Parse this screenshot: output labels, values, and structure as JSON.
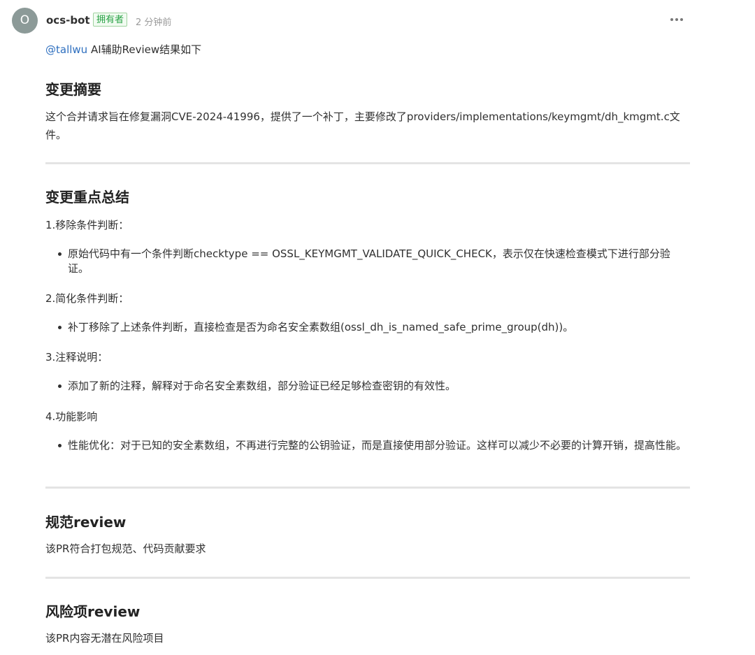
{
  "comment": {
    "avatar_initial": "O",
    "author": "ocs-bot",
    "badge": "拥有者",
    "timestamp": "2 分钟前",
    "mention": "@tallwu",
    "intro_text": " AI辅助Review结果如下"
  },
  "sections": {
    "summary": {
      "heading": "变更摘要",
      "body": "这个合并请求旨在修复漏洞CVE-2024-41996，提供了一个补丁，主要修改了providers/implementations/keymgmt/dh_kmgmt.c文件。"
    },
    "key_points": {
      "heading": "变更重点总结",
      "items": [
        {
          "title": "1.移除条件判断：",
          "bullet": "原始代码中有一个条件判断checktype == OSSL_KEYMGMT_VALIDATE_QUICK_CHECK，表示仅在快速检查模式下进行部分验证。"
        },
        {
          "title": "2.简化条件判断：",
          "bullet": "补丁移除了上述条件判断，直接检查是否为命名安全素数组(ossl_dh_is_named_safe_prime_group(dh))。"
        },
        {
          "title": "3.注释说明：",
          "bullet": "添加了新的注释，解释对于命名安全素数组，部分验证已经足够检查密钥的有效性。"
        },
        {
          "title": "4.功能影响",
          "bullet": "性能优化：对于已知的安全素数组，不再进行完整的公钥验证，而是直接使用部分验证。这样可以减少不必要的计算开销，提高性能。"
        }
      ]
    },
    "spec_review": {
      "heading": "规范review",
      "body": "该PR符合打包规范、代码贡献要求"
    },
    "risk_review": {
      "heading": "风险项review",
      "body": "该PR内容无潜在风险项目"
    }
  },
  "colors": {
    "mention": "#2e6fbf",
    "badge_text": "#27a244",
    "badge_border": "#9fd39f",
    "avatar_bg": "#8c9a98",
    "divider": "#e4e4e4"
  }
}
